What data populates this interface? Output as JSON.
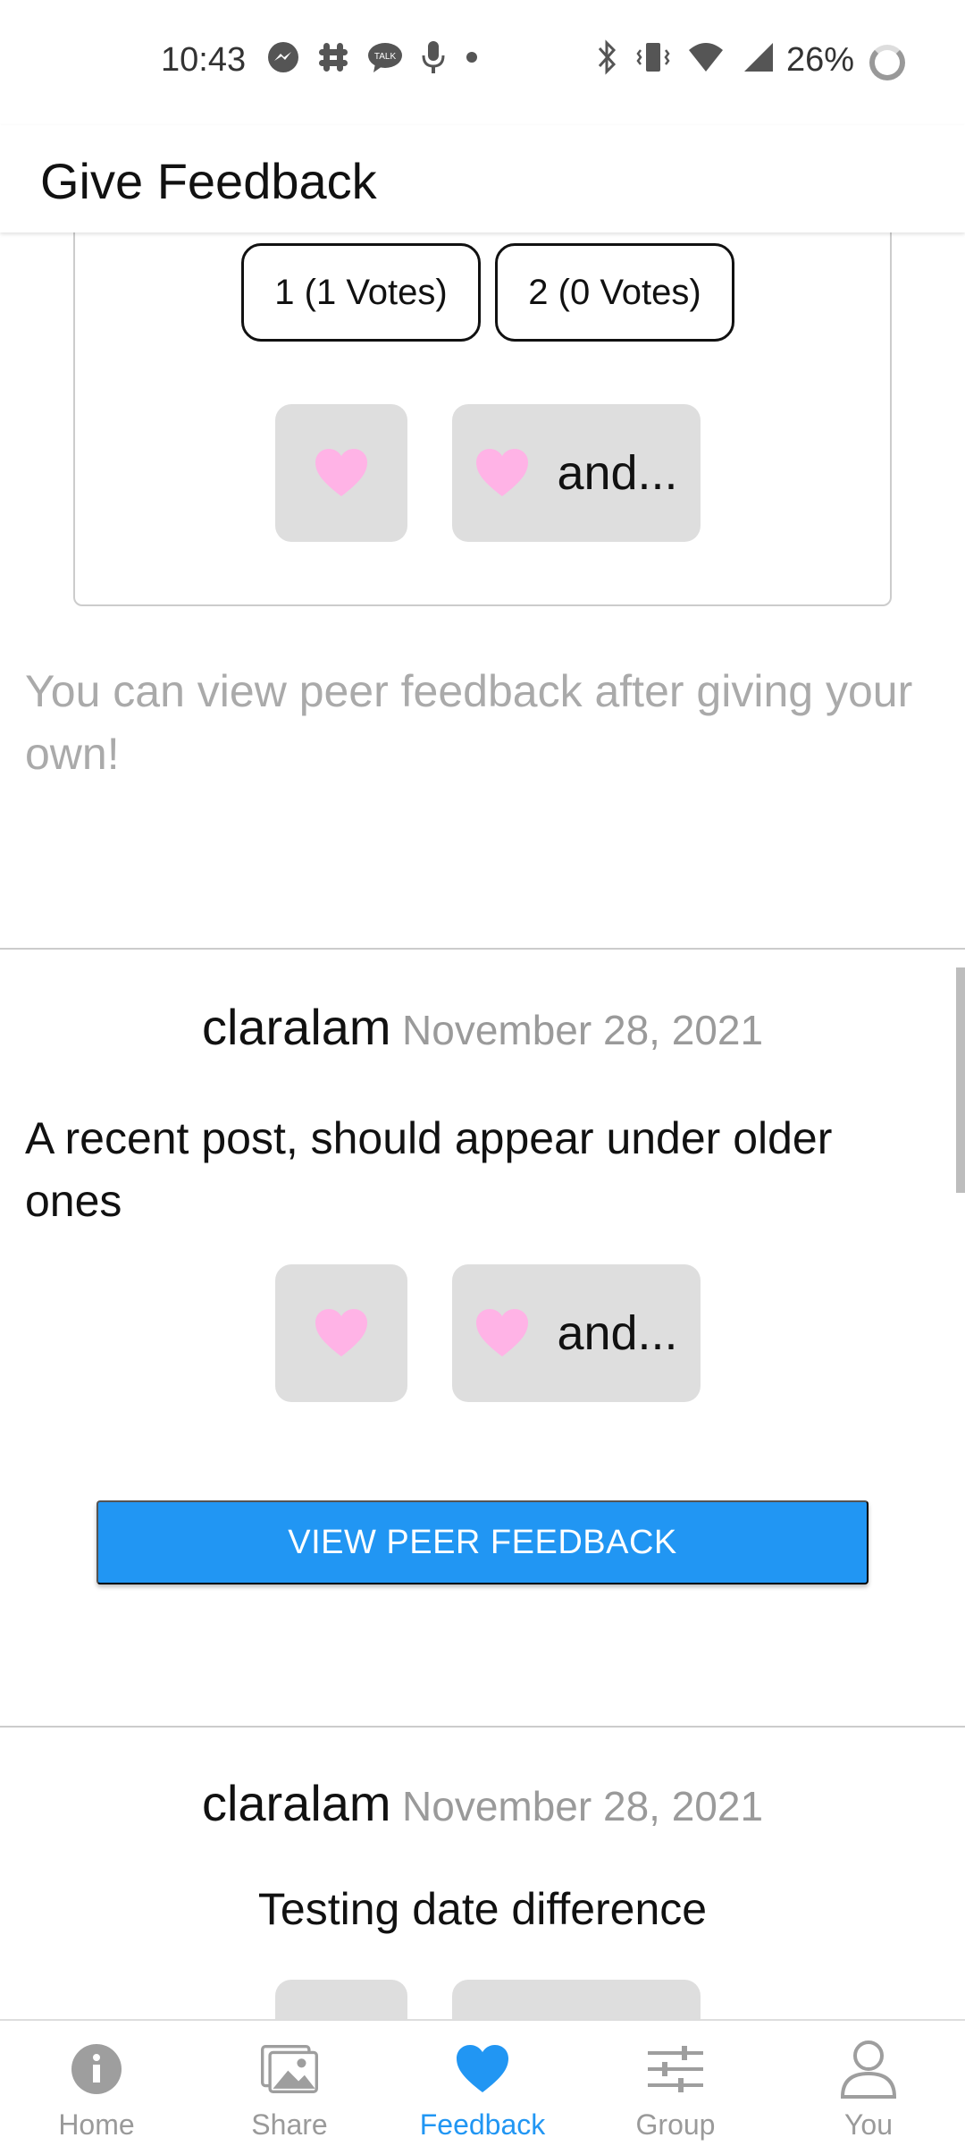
{
  "status_bar": {
    "time": "10:43",
    "battery": "26%",
    "left_icons": [
      "messenger-icon",
      "slack-icon",
      "talk-icon",
      "microphone-icon",
      "dot-icon"
    ],
    "right_icons": [
      "bluetooth-icon",
      "vibrate-icon",
      "wifi-icon",
      "signal-icon",
      "battery-ring-icon"
    ]
  },
  "header": {
    "title": "Give Feedback"
  },
  "poll": {
    "options": [
      {
        "label": "1 (1 Votes)"
      },
      {
        "label": "2 (0 Votes)"
      }
    ]
  },
  "reactions": {
    "more_label": "and..."
  },
  "hint": "You can view peer feedback after giving your own!",
  "posts": [
    {
      "author": "claralam",
      "date": "November 28, 2021",
      "text": "A recent post, should appear under older ones",
      "button_label": "VIEW PEER FEEDBACK"
    },
    {
      "author": "claralam",
      "date": "November 28, 2021",
      "text": "Testing date difference"
    }
  ],
  "bottom_nav": {
    "items": [
      {
        "label": "Home",
        "icon": "info-icon"
      },
      {
        "label": "Share",
        "icon": "image-icon"
      },
      {
        "label": "Feedback",
        "icon": "heart-icon",
        "active": true
      },
      {
        "label": "Group",
        "icon": "sliders-icon"
      },
      {
        "label": "You",
        "icon": "person-icon"
      }
    ]
  },
  "colors": {
    "accent": "#2196F3",
    "heart": "#FFB3E6",
    "reaction_bg": "#DEDEDE",
    "muted_text": "#AAAAAA"
  }
}
